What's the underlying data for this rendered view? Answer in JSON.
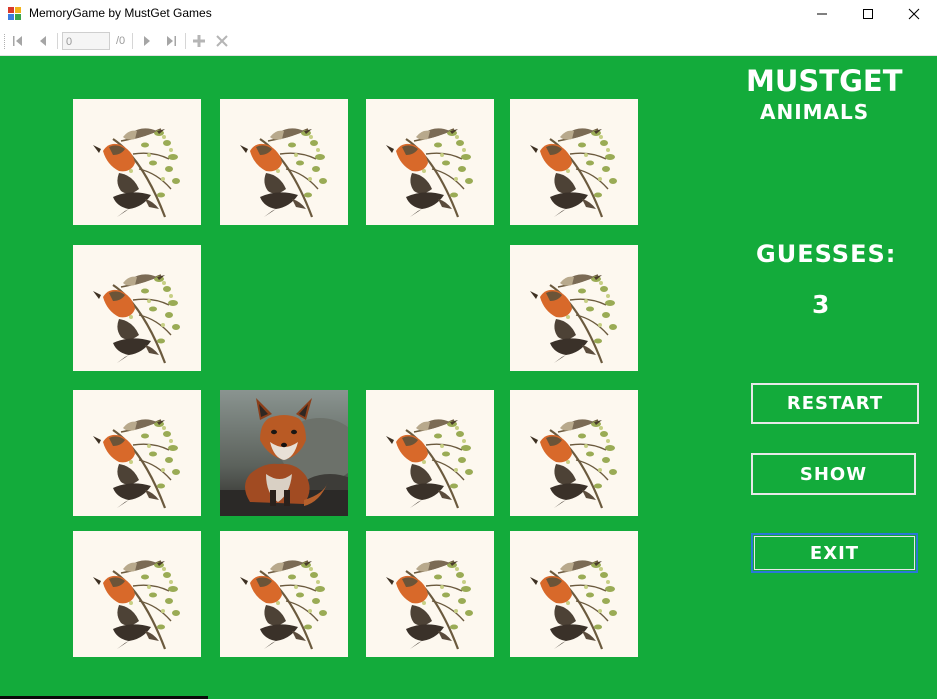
{
  "window": {
    "title": "MemoryGame by MustGet Games",
    "minimize_icon": "minimize-icon",
    "maximize_icon": "maximize-icon",
    "close_icon": "close-icon"
  },
  "navigator": {
    "position_value": "0",
    "count_label": "/0",
    "buttons": [
      "move-first-icon",
      "move-previous-icon",
      "move-next-icon",
      "move-last-icon",
      "add-new-icon",
      "delete-icon"
    ]
  },
  "game": {
    "title": "MUSTGET",
    "subtitle": "ANIMALS",
    "guesses_label": "GUESSES:",
    "guesses_value": "3",
    "restart_label": "RESTART",
    "show_label": "SHOW",
    "exit_label": "EXIT",
    "background_color": "#13ab3b",
    "card_back_color": "#fdf8ef",
    "cards": [
      {
        "state": "hidden",
        "image": "bird-illustration"
      },
      {
        "state": "hidden",
        "image": "bird-illustration"
      },
      {
        "state": "hidden",
        "image": "bird-illustration"
      },
      {
        "state": "hidden",
        "image": "bird-illustration"
      },
      {
        "state": "hidden",
        "image": "bird-illustration"
      },
      {
        "state": "matched",
        "image": ""
      },
      {
        "state": "matched",
        "image": ""
      },
      {
        "state": "hidden",
        "image": "bird-illustration"
      },
      {
        "state": "hidden",
        "image": "bird-illustration"
      },
      {
        "state": "revealed",
        "image": "fox-photo"
      },
      {
        "state": "hidden",
        "image": "bird-illustration"
      },
      {
        "state": "hidden",
        "image": "bird-illustration"
      },
      {
        "state": "hidden",
        "image": "bird-illustration"
      },
      {
        "state": "hidden",
        "image": "bird-illustration"
      },
      {
        "state": "hidden",
        "image": "bird-illustration"
      },
      {
        "state": "hidden",
        "image": "bird-illustration"
      }
    ]
  }
}
